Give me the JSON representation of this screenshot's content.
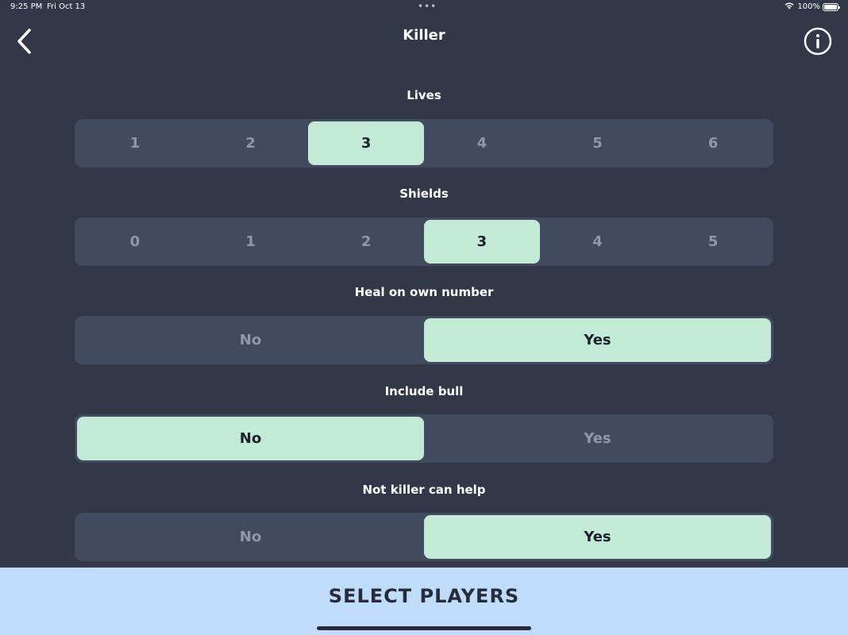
{
  "status_bar": {
    "time": "9:25 PM",
    "date": "Fri Oct 13",
    "dots": "•••",
    "battery": "100%",
    "wifi_icon": "wifi-icon",
    "battery_icon": "battery-icon"
  },
  "nav": {
    "title": "Killer",
    "back_icon": "chevron-left-icon",
    "info_icon": "info-circle-icon"
  },
  "settings": {
    "lives": {
      "label": "Lives",
      "options": [
        "1",
        "2",
        "3",
        "4",
        "5",
        "6"
      ],
      "selected": "3"
    },
    "shields": {
      "label": "Shields",
      "options": [
        "0",
        "1",
        "2",
        "3",
        "4",
        "5"
      ],
      "selected": "3"
    },
    "heal": {
      "label": "Heal on own number",
      "options": [
        "No",
        "Yes"
      ],
      "selected": "Yes"
    },
    "bull": {
      "label": "Include bull",
      "options": [
        "No",
        "Yes"
      ],
      "selected": "No"
    },
    "help": {
      "label": "Not killer can help",
      "options": [
        "No",
        "Yes"
      ],
      "selected": "Yes"
    }
  },
  "cta": {
    "label": "SELECT PLAYERS"
  },
  "colors": {
    "background": "#323848",
    "segment_bg": "#414a5e",
    "selected": "#c2ead6",
    "unselected_text": "#8f98ab",
    "cta_bg": "#bfdcfb"
  }
}
